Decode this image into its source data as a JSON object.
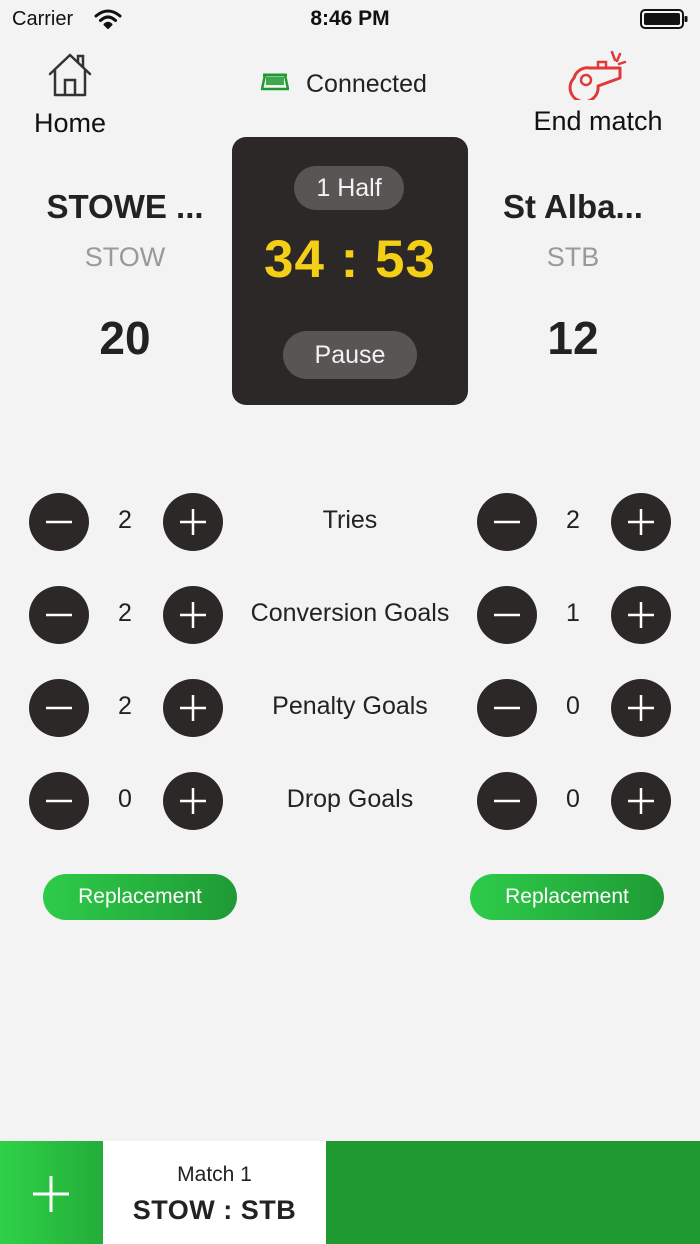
{
  "status_bar": {
    "carrier": "Carrier",
    "time": "8:46 PM",
    "wifi_icon": "wifi-icon",
    "battery_icon": "battery-icon"
  },
  "header": {
    "home_label": "Home",
    "home_icon": "house-icon",
    "connection_status": "Connected",
    "connection_icon": "goal-net-icon",
    "connection_color": "#1e9a30",
    "end_match_label": "End match",
    "end_match_icon": "whistle-icon",
    "end_match_icon_color": "#e0393a"
  },
  "home_team": {
    "name": "STOWE ...",
    "abbr": "STOW",
    "score": "20"
  },
  "away_team": {
    "name": "St Alba...",
    "abbr": "STB",
    "score": "12"
  },
  "timer": {
    "period": "1 Half",
    "time": "34 : 53",
    "pause_label": "Pause",
    "time_color": "#f4cf16"
  },
  "stats": [
    {
      "label": "Tries",
      "home": "2",
      "away": "2"
    },
    {
      "label": "Conversion Goals",
      "home": "2",
      "away": "1"
    },
    {
      "label": "Penalty Goals",
      "home": "2",
      "away": "0"
    },
    {
      "label": "Drop Goals",
      "home": "0",
      "away": "0"
    }
  ],
  "replacement": {
    "home_label": "Replacement",
    "away_label": "Replacement",
    "color": "#22b33c"
  },
  "bottom_bar": {
    "add_icon": "plus-icon",
    "match_title": "Match 1",
    "match_score": "STOW : STB",
    "accent": "#1e9a30"
  }
}
